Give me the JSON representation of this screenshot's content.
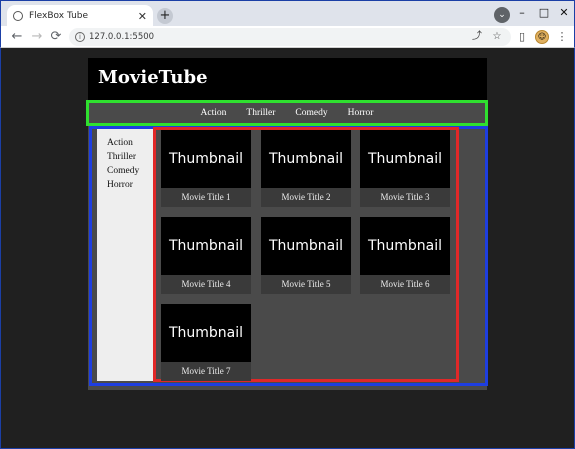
{
  "browser": {
    "tab_title": "FlexBox Tube",
    "tab_close": "✕",
    "new_tab": "+",
    "profile_menu": "⌄",
    "window_controls": {
      "minimize": "–",
      "maximize": "□",
      "close": "✕"
    },
    "nav": {
      "back": "←",
      "forward": "→",
      "reload": "⟳"
    },
    "address": "127.0.0.1:5500",
    "icons": {
      "info": "info-icon",
      "share": "share-icon",
      "bookmark": "star-icon",
      "side_panel": "side-panel-icon",
      "profile": "avatar-icon",
      "menu": "kebab-menu-icon"
    },
    "glyphs": {
      "info": "i",
      "share": "⤴",
      "bookmark": "☆",
      "side_panel": "▯",
      "profile": "☺",
      "menu": "⋮"
    }
  },
  "page": {
    "site_title": "MovieTube",
    "topnav": [
      "Action",
      "Thriller",
      "Comedy",
      "Horror"
    ],
    "sidebar": [
      "Action",
      "Thriller",
      "Comedy",
      "Horror"
    ],
    "movies": [
      {
        "thumbnail": "Thumbnail",
        "title": "Movie Title 1"
      },
      {
        "thumbnail": "Thumbnail",
        "title": "Movie Title 2"
      },
      {
        "thumbnail": "Thumbnail",
        "title": "Movie Title 3"
      },
      {
        "thumbnail": "Thumbnail",
        "title": "Movie Title 4"
      },
      {
        "thumbnail": "Thumbnail",
        "title": "Movie Title 5"
      },
      {
        "thumbnail": "Thumbnail",
        "title": "Movie Title 6"
      },
      {
        "thumbnail": "Thumbnail",
        "title": "Movie Title 7"
      }
    ]
  },
  "colors": {
    "header_bg": "#000000",
    "body_bg": "#4a4a4a",
    "sidebar_bg": "#eeeeee",
    "outline_green": "#2fe02f",
    "outline_blue": "#1e3ee0",
    "outline_red": "#e02828",
    "window_frame": "#1b3fa6"
  }
}
